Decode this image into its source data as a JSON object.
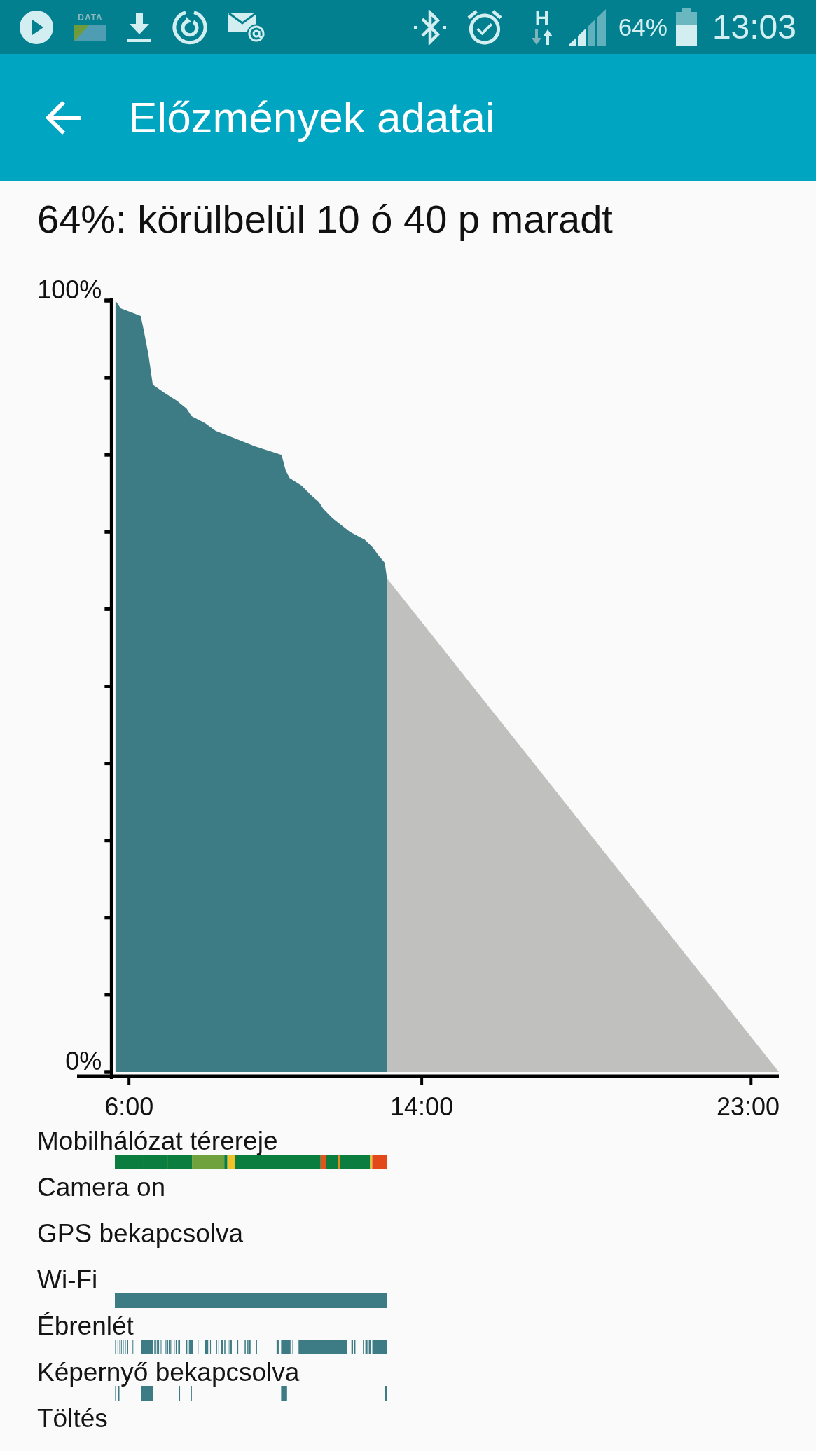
{
  "status_bar": {
    "data_label": "DATA",
    "network_type": "H",
    "battery_percent": "64%",
    "time": "13:03"
  },
  "header": {
    "title": "Előzmények adatai"
  },
  "summary": "64%: körülbelül 10 ó 40 p maradt",
  "battery_chart": {
    "chart_data": {
      "type": "area",
      "x": [
        5.63,
        5.77,
        6.32,
        6.4,
        6.53,
        6.65,
        6.95,
        7.31,
        7.57,
        7.71,
        8.08,
        8.37,
        9.44,
        10.17,
        10.28,
        10.39,
        10.72,
        10.97,
        11.19,
        11.31,
        11.56,
        12.04,
        12.44,
        12.66,
        12.81,
        12.99,
        13.05,
        23.76
      ],
      "series": [
        {
          "color": "#3d7b85",
          "values": [
            100,
            99,
            98,
            96.2,
            93,
            89.1,
            88.1,
            87,
            86,
            85,
            84.1,
            83.1,
            81.1,
            80,
            78,
            77,
            76,
            74.8,
            73.9,
            73,
            71.8,
            70,
            69,
            68,
            67,
            66,
            64,
            null
          ]
        },
        {
          "color": "#c0c0be",
          "values": [
            null,
            null,
            null,
            null,
            null,
            null,
            null,
            null,
            null,
            null,
            null,
            null,
            null,
            null,
            null,
            null,
            null,
            null,
            null,
            null,
            null,
            null,
            null,
            null,
            null,
            null,
            64,
            0
          ]
        }
      ],
      "xlim": [
        4.58,
        23.76
      ],
      "ylim": [
        0,
        100
      ],
      "xticks": [
        {
          "value": 6,
          "label": "6:00"
        },
        {
          "value": 14,
          "label": "14:00"
        },
        {
          "value": 23,
          "label": "23:00"
        }
      ],
      "yticks": [
        {
          "value": 100,
          "label": "100%"
        },
        {
          "value": 0,
          "label": "0%"
        }
      ]
    }
  },
  "timelines": [
    {
      "label": "Mobilhálózat térereje",
      "kind": "signal"
    },
    {
      "label": "Camera on",
      "kind": "empty"
    },
    {
      "label": "GPS bekapcsolva",
      "kind": "empty"
    },
    {
      "label": "Wi-Fi",
      "kind": "wifi"
    },
    {
      "label": "Ébrenlét",
      "kind": "awake"
    },
    {
      "label": "Képernyő bekapcsolva",
      "kind": "screen"
    },
    {
      "label": "Töltés",
      "kind": "empty"
    }
  ]
}
